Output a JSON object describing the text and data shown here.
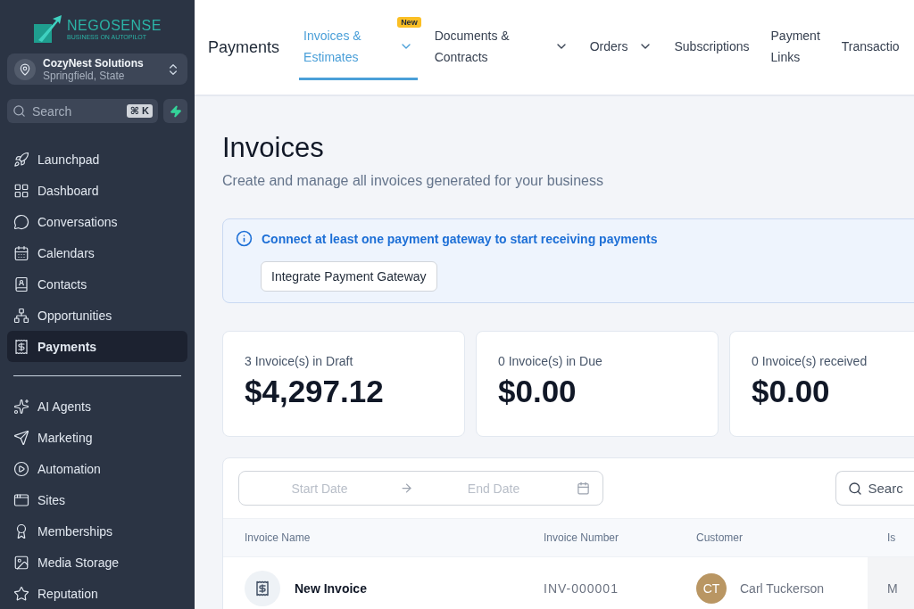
{
  "logo": {
    "name": "NEGOSENSE",
    "tagline": "BUSINESS ON AUTOPILOT"
  },
  "account": {
    "name": "CozyNest Solutions",
    "location": "Springfield, State"
  },
  "sidebar_search": {
    "placeholder": "Search",
    "shortcut": "⌘ K"
  },
  "sidebar": {
    "items": [
      {
        "label": "Launchpad",
        "selected": false
      },
      {
        "label": "Dashboard",
        "selected": false
      },
      {
        "label": "Conversations",
        "selected": false
      },
      {
        "label": "Calendars",
        "selected": false
      },
      {
        "label": "Contacts",
        "selected": false
      },
      {
        "label": "Opportunities",
        "selected": false
      },
      {
        "label": "Payments",
        "selected": true
      }
    ],
    "items_2": [
      {
        "label": "AI Agents",
        "selected": false
      },
      {
        "label": "Marketing",
        "selected": false
      },
      {
        "label": "Automation",
        "selected": false
      },
      {
        "label": "Sites",
        "selected": false
      },
      {
        "label": "Memberships",
        "selected": false
      },
      {
        "label": "Media Storage",
        "selected": false
      },
      {
        "label": "Reputation",
        "selected": false
      }
    ]
  },
  "header": {
    "title": "Payments",
    "tabs": [
      {
        "label": "Invoices &\nEstimates",
        "selected": true,
        "badge": "New",
        "dropdown": true
      },
      {
        "label": "Documents &\nContracts",
        "selected": false,
        "dropdown": true
      },
      {
        "label": "Orders",
        "selected": false,
        "dropdown": true
      },
      {
        "label": "Subscriptions",
        "selected": false,
        "dropdown": false
      },
      {
        "label": "Payment\nLinks",
        "selected": false,
        "dropdown": false
      },
      {
        "label": "Transactio",
        "selected": false,
        "dropdown": false
      }
    ]
  },
  "page": {
    "title": "Invoices",
    "subtitle": "Create and manage all invoices generated for your business"
  },
  "banner": {
    "message": "Connect at least one payment gateway to start receiving payments",
    "button": "Integrate Payment Gateway"
  },
  "stats": [
    {
      "label": "3 Invoice(s) in Draft",
      "value": "$4,297.12"
    },
    {
      "label": "0 Invoice(s) in Due",
      "value": "$0.00"
    },
    {
      "label": "0 Invoice(s) received",
      "value": "$0.00"
    }
  ],
  "table": {
    "start_date": {
      "placeholder": "Start Date"
    },
    "end_date": {
      "placeholder": "End Date"
    },
    "search": {
      "placeholder": "Searc"
    },
    "columns": [
      "Invoice Name",
      "Invoice Number",
      "Customer",
      "Is"
    ],
    "rows": [
      {
        "name": "New Invoice",
        "number": "INV-000001",
        "initials": "CT",
        "customer": "Carl Tuckerson",
        "column_4": "M"
      }
    ]
  }
}
